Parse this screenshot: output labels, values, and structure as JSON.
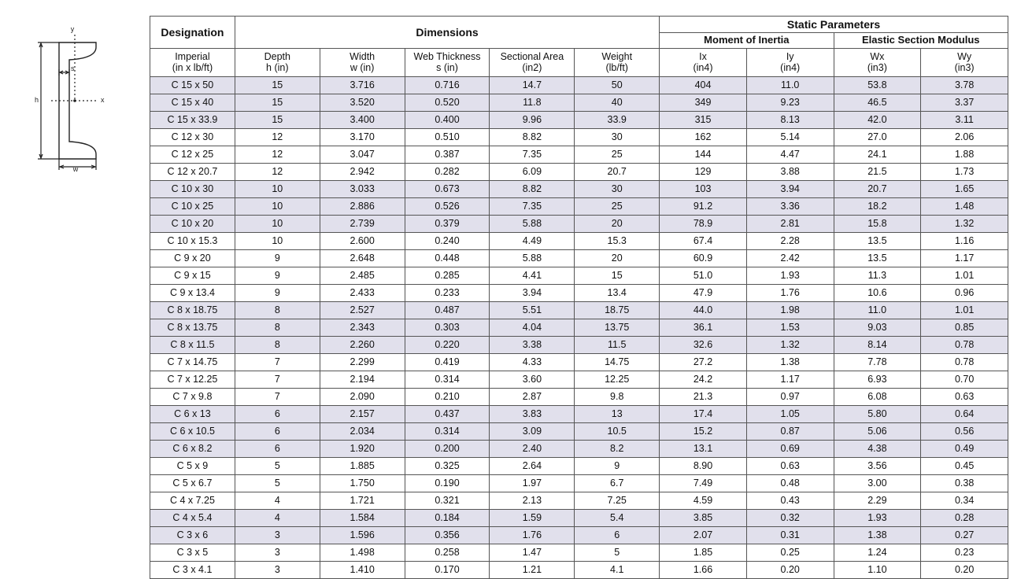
{
  "diagram": {
    "y_label": "y",
    "x_label": "x",
    "h_label": "h",
    "s_label": "s",
    "w_label": "w"
  },
  "headers": {
    "designation": "Designation",
    "dimensions": "Dimensions",
    "static": "Static Parameters",
    "moment": "Moment of Inertia",
    "elastic": "Elastic Section Modulus",
    "col_imperial": "Imperial",
    "col_imperial_sub": "(in x lb/ft)",
    "col_depth": "Depth",
    "col_depth_sub": "h (in)",
    "col_width": "Width",
    "col_width_sub": "w (in)",
    "col_web": "Web Thickness",
    "col_web_sub": "s (in)",
    "col_area": "Sectional Area",
    "col_area_sub": "(in2)",
    "col_weight": "Weight",
    "col_weight_sub": "(lb/ft)",
    "col_ix": "Ix",
    "col_ix_sub": "(in4)",
    "col_iy": "Iy",
    "col_iy_sub": "(in4)",
    "col_wx": "Wx",
    "col_wx_sub": "(in3)",
    "col_wy": "Wy",
    "col_wy_sub": "(in3)"
  },
  "rows": [
    {
      "d": "C 15 x 50",
      "h": "15",
      "w": "3.716",
      "s": "0.716",
      "a": "14.7",
      "wt": "50",
      "ix": "404",
      "iy": "11.0",
      "wx": "53.8",
      "wy": "3.78"
    },
    {
      "d": "C 15 x 40",
      "h": "15",
      "w": "3.520",
      "s": "0.520",
      "a": "11.8",
      "wt": "40",
      "ix": "349",
      "iy": "9.23",
      "wx": "46.5",
      "wy": "3.37"
    },
    {
      "d": "C 15 x 33.9",
      "h": "15",
      "w": "3.400",
      "s": "0.400",
      "a": "9.96",
      "wt": "33.9",
      "ix": "315",
      "iy": "8.13",
      "wx": "42.0",
      "wy": "3.11"
    },
    {
      "d": "C 12 x 30",
      "h": "12",
      "w": "3.170",
      "s": "0.510",
      "a": "8.82",
      "wt": "30",
      "ix": "162",
      "iy": "5.14",
      "wx": "27.0",
      "wy": "2.06"
    },
    {
      "d": "C 12 x 25",
      "h": "12",
      "w": "3.047",
      "s": "0.387",
      "a": "7.35",
      "wt": "25",
      "ix": "144",
      "iy": "4.47",
      "wx": "24.1",
      "wy": "1.88"
    },
    {
      "d": "C 12 x 20.7",
      "h": "12",
      "w": "2.942",
      "s": "0.282",
      "a": "6.09",
      "wt": "20.7",
      "ix": "129",
      "iy": "3.88",
      "wx": "21.5",
      "wy": "1.73"
    },
    {
      "d": "C 10 x 30",
      "h": "10",
      "w": "3.033",
      "s": "0.673",
      "a": "8.82",
      "wt": "30",
      "ix": "103",
      "iy": "3.94",
      "wx": "20.7",
      "wy": "1.65"
    },
    {
      "d": "C 10 x 25",
      "h": "10",
      "w": "2.886",
      "s": "0.526",
      "a": "7.35",
      "wt": "25",
      "ix": "91.2",
      "iy": "3.36",
      "wx": "18.2",
      "wy": "1.48"
    },
    {
      "d": "C 10 x 20",
      "h": "10",
      "w": "2.739",
      "s": "0.379",
      "a": "5.88",
      "wt": "20",
      "ix": "78.9",
      "iy": "2.81",
      "wx": "15.8",
      "wy": "1.32"
    },
    {
      "d": "C 10 x 15.3",
      "h": "10",
      "w": "2.600",
      "s": "0.240",
      "a": "4.49",
      "wt": "15.3",
      "ix": "67.4",
      "iy": "2.28",
      "wx": "13.5",
      "wy": "1.16"
    },
    {
      "d": "C 9 x 20",
      "h": "9",
      "w": "2.648",
      "s": "0.448",
      "a": "5.88",
      "wt": "20",
      "ix": "60.9",
      "iy": "2.42",
      "wx": "13.5",
      "wy": "1.17"
    },
    {
      "d": "C 9 x 15",
      "h": "9",
      "w": "2.485",
      "s": "0.285",
      "a": "4.41",
      "wt": "15",
      "ix": "51.0",
      "iy": "1.93",
      "wx": "11.3",
      "wy": "1.01"
    },
    {
      "d": "C 9 x 13.4",
      "h": "9",
      "w": "2.433",
      "s": "0.233",
      "a": "3.94",
      "wt": "13.4",
      "ix": "47.9",
      "iy": "1.76",
      "wx": "10.6",
      "wy": "0.96"
    },
    {
      "d": "C 8 x 18.75",
      "h": "8",
      "w": "2.527",
      "s": "0.487",
      "a": "5.51",
      "wt": "18.75",
      "ix": "44.0",
      "iy": "1.98",
      "wx": "11.0",
      "wy": "1.01"
    },
    {
      "d": "C 8 x 13.75",
      "h": "8",
      "w": "2.343",
      "s": "0.303",
      "a": "4.04",
      "wt": "13.75",
      "ix": "36.1",
      "iy": "1.53",
      "wx": "9.03",
      "wy": "0.85"
    },
    {
      "d": "C 8 x 11.5",
      "h": "8",
      "w": "2.260",
      "s": "0.220",
      "a": "3.38",
      "wt": "11.5",
      "ix": "32.6",
      "iy": "1.32",
      "wx": "8.14",
      "wy": "0.78"
    },
    {
      "d": "C 7 x 14.75",
      "h": "7",
      "w": "2.299",
      "s": "0.419",
      "a": "4.33",
      "wt": "14.75",
      "ix": "27.2",
      "iy": "1.38",
      "wx": "7.78",
      "wy": "0.78"
    },
    {
      "d": "C 7 x 12.25",
      "h": "7",
      "w": "2.194",
      "s": "0.314",
      "a": "3.60",
      "wt": "12.25",
      "ix": "24.2",
      "iy": "1.17",
      "wx": "6.93",
      "wy": "0.70"
    },
    {
      "d": "C 7 x 9.8",
      "h": "7",
      "w": "2.090",
      "s": "0.210",
      "a": "2.87",
      "wt": "9.8",
      "ix": "21.3",
      "iy": "0.97",
      "wx": "6.08",
      "wy": "0.63"
    },
    {
      "d": "C 6 x 13",
      "h": "6",
      "w": "2.157",
      "s": "0.437",
      "a": "3.83",
      "wt": "13",
      "ix": "17.4",
      "iy": "1.05",
      "wx": "5.80",
      "wy": "0.64"
    },
    {
      "d": "C 6 x 10.5",
      "h": "6",
      "w": "2.034",
      "s": "0.314",
      "a": "3.09",
      "wt": "10.5",
      "ix": "15.2",
      "iy": "0.87",
      "wx": "5.06",
      "wy": "0.56"
    },
    {
      "d": "C 6 x 8.2",
      "h": "6",
      "w": "1.920",
      "s": "0.200",
      "a": "2.40",
      "wt": "8.2",
      "ix": "13.1",
      "iy": "0.69",
      "wx": "4.38",
      "wy": "0.49"
    },
    {
      "d": "C 5 x 9",
      "h": "5",
      "w": "1.885",
      "s": "0.325",
      "a": "2.64",
      "wt": "9",
      "ix": "8.90",
      "iy": "0.63",
      "wx": "3.56",
      "wy": "0.45"
    },
    {
      "d": "C 5 x 6.7",
      "h": "5",
      "w": "1.750",
      "s": "0.190",
      "a": "1.97",
      "wt": "6.7",
      "ix": "7.49",
      "iy": "0.48",
      "wx": "3.00",
      "wy": "0.38"
    },
    {
      "d": "C 4 x 7.25",
      "h": "4",
      "w": "1.721",
      "s": "0.321",
      "a": "2.13",
      "wt": "7.25",
      "ix": "4.59",
      "iy": "0.43",
      "wx": "2.29",
      "wy": "0.34"
    },
    {
      "d": "C 4 x 5.4",
      "h": "4",
      "w": "1.584",
      "s": "0.184",
      "a": "1.59",
      "wt": "5.4",
      "ix": "3.85",
      "iy": "0.32",
      "wx": "1.93",
      "wy": "0.28"
    },
    {
      "d": "C 3 x 6",
      "h": "3",
      "w": "1.596",
      "s": "0.356",
      "a": "1.76",
      "wt": "6",
      "ix": "2.07",
      "iy": "0.31",
      "wx": "1.38",
      "wy": "0.27"
    },
    {
      "d": "C 3 x 5",
      "h": "3",
      "w": "1.498",
      "s": "0.258",
      "a": "1.47",
      "wt": "5",
      "ix": "1.85",
      "iy": "0.25",
      "wx": "1.24",
      "wy": "0.23"
    },
    {
      "d": "C 3 x 4.1",
      "h": "3",
      "w": "1.410",
      "s": "0.170",
      "a": "1.21",
      "wt": "4.1",
      "ix": "1.66",
      "iy": "0.20",
      "wx": "1.10",
      "wy": "0.20"
    }
  ],
  "shade_groups": [
    3,
    3,
    3,
    4,
    3,
    3,
    3,
    3,
    2,
    2
  ]
}
